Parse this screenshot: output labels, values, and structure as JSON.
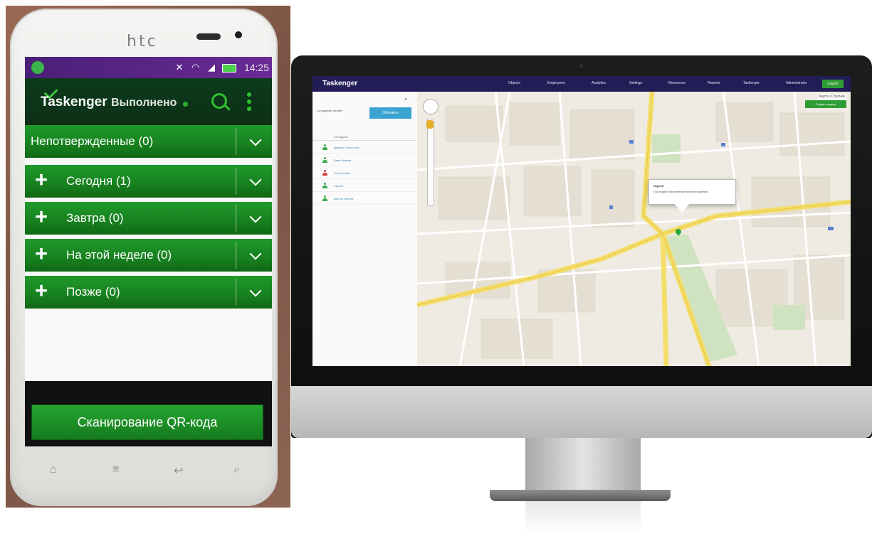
{
  "phone": {
    "brand": "htc",
    "status_time": "14:25",
    "app_title": "Taskenger",
    "status_label": "Выполнено",
    "categories": [
      {
        "label": "Непотвержденные (0)",
        "expandable": false
      },
      {
        "label": "Сегодня (1)",
        "expandable": true
      },
      {
        "label": "Завтра (0)",
        "expandable": true
      },
      {
        "label": "На этой неделе (0)",
        "expandable": true
      },
      {
        "label": "Позже (0)",
        "expandable": true
      }
    ],
    "qr_button": "Сканирование QR-кода",
    "colors": {
      "accent": "#1c8f26",
      "statusbar": "#5b2487",
      "actionbar": "#0d3418"
    }
  },
  "desktop": {
    "logo": "Taskenger",
    "nav": [
      "Objects",
      "Employees",
      "Analytics",
      "Settings",
      "Resources",
      "Reports",
      "Taskenger",
      "Administrator"
    ],
    "nav_button": "Logout",
    "sidebar": {
      "radio_label": "Сотрудники онлайн",
      "button": "Обновить",
      "header": "Сотрудник",
      "employees": [
        {
          "name": "Данияр Полностью",
          "status": "online"
        },
        {
          "name": "Иван Иванов",
          "status": "online"
        },
        {
          "name": "Антон Бойко",
          "status": "busy"
        },
        {
          "name": "Сергей",
          "status": "online"
        },
        {
          "name": "Виктор Петров",
          "status": "online"
        }
      ]
    },
    "map": {
      "map_type": "Карта | Спутник",
      "create_button": "Создать задачу",
      "popup_title": "Сергей",
      "popup_text": "Последнее обновление местоположения"
    },
    "colors": {
      "nav": "#231d57",
      "button_blue": "#3aa3d1",
      "button_green": "#2f9d36",
      "road": "#f4de6a",
      "park": "#cfe3c0"
    }
  }
}
